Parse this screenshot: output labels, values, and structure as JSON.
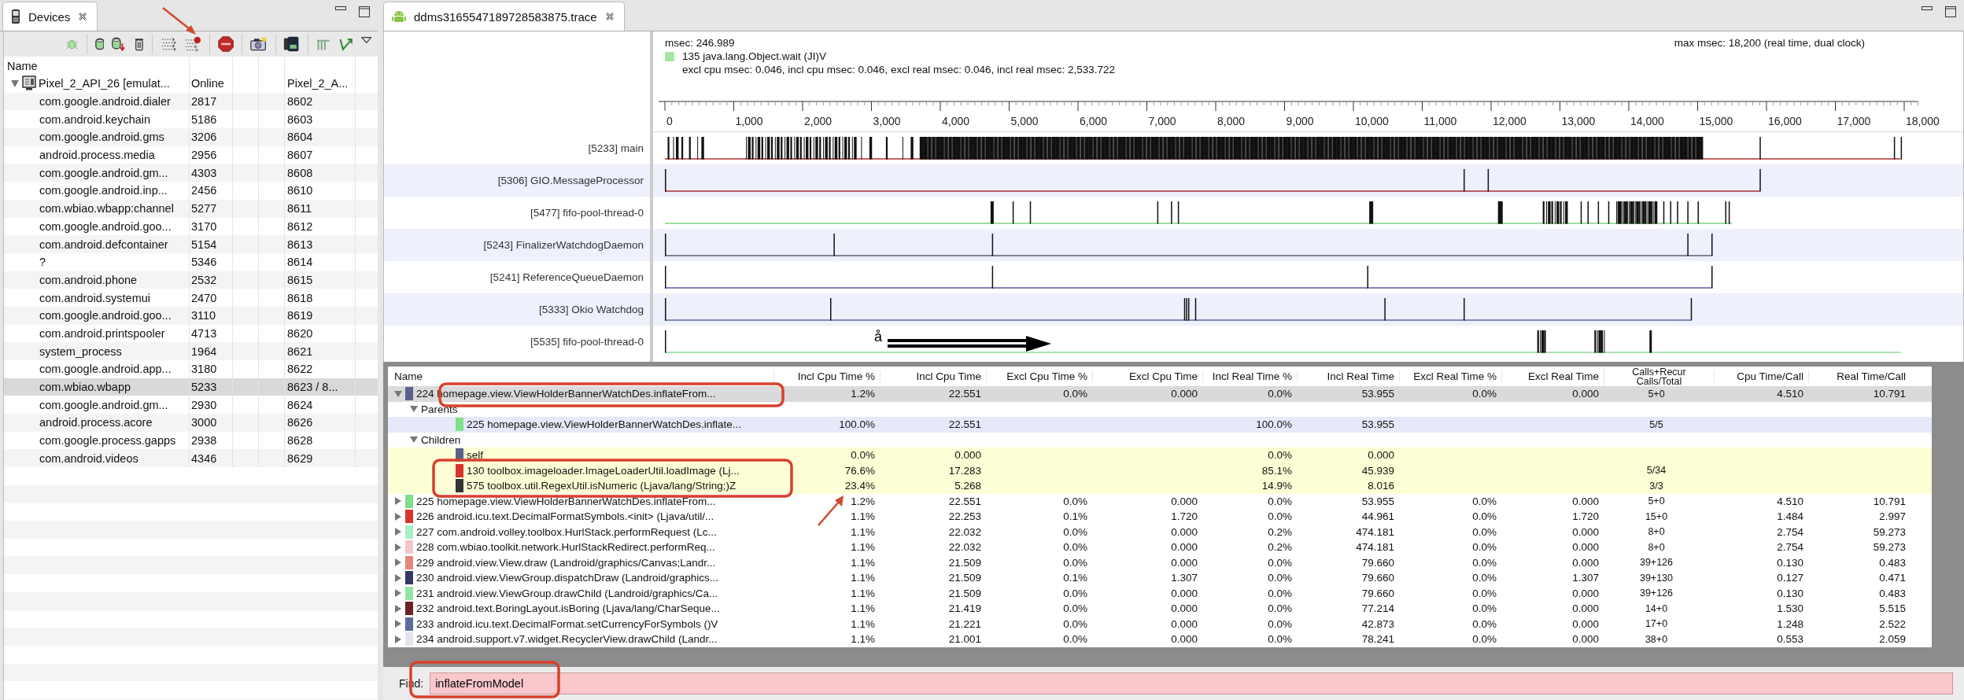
{
  "devices_panel": {
    "tab": {
      "label": "Devices"
    },
    "columns": [
      "Name"
    ],
    "devices": [
      {
        "name": "Pixel_2_API_26 [emulat...",
        "status": "Online",
        "serial": "Pixel_2_A...",
        "expanded": true,
        "children": [
          {
            "name": "com.google.android.dialer",
            "pid": "2817",
            "port": "8602",
            "selected": false
          },
          {
            "name": "com.android.keychain",
            "pid": "5186",
            "port": "8603",
            "selected": false
          },
          {
            "name": "com.google.android.gms",
            "pid": "3206",
            "port": "8604",
            "selected": false
          },
          {
            "name": "android.process.media",
            "pid": "2956",
            "port": "8607",
            "selected": false
          },
          {
            "name": "com.google.android.gm...",
            "pid": "4303",
            "port": "8608",
            "selected": false
          },
          {
            "name": "com.google.android.inp...",
            "pid": "2456",
            "port": "8610",
            "selected": false
          },
          {
            "name": "com.wbiao.wbapp:channel",
            "pid": "5277",
            "port": "8611",
            "selected": false
          },
          {
            "name": "com.google.android.goo...",
            "pid": "3170",
            "port": "8612",
            "selected": false
          },
          {
            "name": "com.android.defcontainer",
            "pid": "5154",
            "port": "8613",
            "selected": false
          },
          {
            "name": "?",
            "pid": "5346",
            "port": "8614",
            "selected": false
          },
          {
            "name": "com.android.phone",
            "pid": "2532",
            "port": "8615",
            "selected": false
          },
          {
            "name": "com.android.systemui",
            "pid": "2470",
            "port": "8618",
            "selected": false
          },
          {
            "name": "com.google.android.goo...",
            "pid": "3110",
            "port": "8619",
            "selected": false
          },
          {
            "name": "com.android.printspooler",
            "pid": "4713",
            "port": "8620",
            "selected": false
          },
          {
            "name": "system_process",
            "pid": "1964",
            "port": "8621",
            "selected": false
          },
          {
            "name": "com.google.android.app...",
            "pid": "3180",
            "port": "8622",
            "selected": false
          },
          {
            "name": "com.wbiao.wbapp",
            "pid": "5233",
            "port": "8623 / 8...",
            "selected": true
          },
          {
            "name": "com.google.android.gm...",
            "pid": "2930",
            "port": "8624",
            "selected": false
          },
          {
            "name": "android.process.acore",
            "pid": "3000",
            "port": "8626",
            "selected": false
          },
          {
            "name": "com.google.process.gapps",
            "pid": "2938",
            "port": "8628",
            "selected": false
          },
          {
            "name": "com.android.videos",
            "pid": "4346",
            "port": "8629",
            "selected": false
          }
        ]
      }
    ]
  },
  "trace_panel": {
    "tab": {
      "label": "ddms3165547189728583875.trace"
    },
    "info": {
      "msec": "msec: 246.989",
      "method": "135 java.lang.Object.wait (JI)V",
      "stats": "excl cpu msec: 0.046, incl cpu msec: 0.046, excl real msec: 0.046, incl real msec: 2,533.722",
      "max": "max msec: 18,200 (real time, dual clock)"
    },
    "ruler_labels": [
      "0",
      "1,000",
      "2,000",
      "3,000",
      "4,000",
      "5,000",
      "6,000",
      "7,000",
      "8,000",
      "9,000",
      "10,000",
      "11,000",
      "12,000",
      "13,000",
      "14,000",
      "15,000",
      "16,000",
      "17,000",
      "18,000"
    ],
    "threads": [
      {
        "name": "[5233] main"
      },
      {
        "name": "[5306] GIO.MessageProcessor"
      },
      {
        "name": "[5477] fifo-pool-thread-0"
      },
      {
        "name": "[5243] FinalizerWatchdogDaemon"
      },
      {
        "name": "[5241] ReferenceQueueDaemon"
      },
      {
        "name": "[5333] Okio Watchdog"
      },
      {
        "name": "[5535] fifo-pool-thread-0"
      }
    ],
    "annotation_mark": "å",
    "table": {
      "columns": [
        "Name",
        "Incl Cpu Time %",
        "Incl Cpu Time",
        "Excl Cpu Time %",
        "Excl Cpu Time",
        "Incl Real Time %",
        "Incl Real Time",
        "Excl Real Time %",
        "Excl Real Time",
        "Calls+Recur Calls/Total",
        "Cpu Time/Call",
        "Real Time/Call"
      ],
      "rows": [
        {
          "kind": "method",
          "expanded": true,
          "selected": true,
          "color": "#5b5f8c",
          "name": "224 homepage.view.ViewHolderBannerWatchDes.inflateFrom...",
          "cells": [
            "1.2%",
            "22.551",
            "0.0%",
            "0.000",
            "0.0%",
            "53.955",
            "0.0%",
            "0.000",
            "5+0",
            "4.510",
            "10.791"
          ]
        },
        {
          "kind": "group",
          "expanded": true,
          "name": "Parents"
        },
        {
          "kind": "parent",
          "color": "#7fe08c",
          "name": "225 homepage.view.ViewHolderBannerWatchDes.inflate...",
          "cells": [
            "100.0%",
            "22.551",
            null,
            null,
            "100.0%",
            "53.955",
            null,
            null,
            "5/5",
            null,
            null
          ]
        },
        {
          "kind": "group",
          "expanded": true,
          "name": "Children"
        },
        {
          "kind": "child",
          "color": "#5b5f8c",
          "name": "self",
          "cells": [
            "0.0%",
            "0.000",
            null,
            null,
            "0.0%",
            "0.000",
            null,
            null,
            null,
            null,
            null
          ]
        },
        {
          "kind": "child",
          "color": "#d8352a",
          "name": "130 toolbox.imageloader.ImageLoaderUtil.loadImage (Lj...",
          "cells": [
            "76.6%",
            "17.283",
            null,
            null,
            "85.1%",
            "45.939",
            null,
            null,
            "5/34",
            null,
            null
          ]
        },
        {
          "kind": "child",
          "color": "#333333",
          "name": "575 toolbox.util.RegexUtil.isNumeric (Ljava/lang/String;)Z",
          "cells": [
            "23.4%",
            "5.268",
            null,
            null,
            "14.9%",
            "8.016",
            null,
            null,
            "3/3",
            null,
            null
          ]
        },
        {
          "kind": "method",
          "expanded": false,
          "selected": false,
          "color": "#7fe08c",
          "name": "225 homepage.view.ViewHolderBannerWatchDes.inflateFrom...",
          "cells": [
            "1.2%",
            "22.551",
            "0.0%",
            "0.000",
            "0.0%",
            "53.955",
            "0.0%",
            "0.000",
            "5+0",
            "4.510",
            "10.791"
          ]
        },
        {
          "kind": "method",
          "expanded": false,
          "selected": false,
          "color": "#d8352a",
          "name": "226 android.icu.text.DecimalFormatSymbols.<init> (Ljava/util/...",
          "cells": [
            "1.1%",
            "22.253",
            "0.1%",
            "1.720",
            "0.0%",
            "44.961",
            "0.0%",
            "1.720",
            "15+0",
            "1.484",
            "2.997"
          ]
        },
        {
          "kind": "method",
          "expanded": false,
          "selected": false,
          "color": "#a6f0c8",
          "name": "227 com.android.volley.toolbox.HurlStack.performRequest (Lc...",
          "cells": [
            "1.1%",
            "22.032",
            "0.0%",
            "0.000",
            "0.2%",
            "474.181",
            "0.0%",
            "0.000",
            "8+0",
            "2.754",
            "59.273"
          ]
        },
        {
          "kind": "method",
          "expanded": false,
          "selected": false,
          "color": "#f2c6ca",
          "name": "228 com.wbiao.toolkit.network.HurlStackRedirect.performReq...",
          "cells": [
            "1.1%",
            "22.032",
            "0.0%",
            "0.000",
            "0.2%",
            "474.181",
            "0.0%",
            "0.000",
            "8+0",
            "2.754",
            "59.273"
          ]
        },
        {
          "kind": "method",
          "expanded": false,
          "selected": false,
          "color": "#e0887a",
          "name": "229 android.view.View.draw (Landroid/graphics/Canvas;Landr...",
          "cells": [
            "1.1%",
            "21.509",
            "0.0%",
            "0.000",
            "0.0%",
            "79.660",
            "0.0%",
            "0.000",
            "39+126",
            "0.130",
            "0.483"
          ]
        },
        {
          "kind": "method",
          "expanded": false,
          "selected": false,
          "color": "#383868",
          "name": "230 android.view.ViewGroup.dispatchDraw (Landroid/graphics...",
          "cells": [
            "1.1%",
            "21.509",
            "0.1%",
            "1.307",
            "0.0%",
            "79.660",
            "0.0%",
            "1.307",
            "39+130",
            "0.127",
            "0.471"
          ]
        },
        {
          "kind": "method",
          "expanded": false,
          "selected": false,
          "color": "#92e6a2",
          "name": "231 android.view.ViewGroup.drawChild (Landroid/graphics/Ca...",
          "cells": [
            "1.1%",
            "21.509",
            "0.0%",
            "0.000",
            "0.0%",
            "79.660",
            "0.0%",
            "0.000",
            "39+126",
            "0.130",
            "0.483"
          ]
        },
        {
          "kind": "method",
          "expanded": false,
          "selected": false,
          "color": "#6a2222",
          "name": "232 android.text.BoringLayout.isBoring (Ljava/lang/CharSeque...",
          "cells": [
            "1.1%",
            "21.419",
            "0.0%",
            "0.000",
            "0.0%",
            "77.214",
            "0.0%",
            "0.000",
            "14+0",
            "1.530",
            "5.515"
          ]
        },
        {
          "kind": "method",
          "expanded": false,
          "selected": false,
          "color": "#5e6c9c",
          "name": "233 android.icu.text.DecimalFormat.setCurrencyForSymbols ()V",
          "cells": [
            "1.1%",
            "21.221",
            "0.0%",
            "0.000",
            "0.0%",
            "42.873",
            "0.0%",
            "0.000",
            "17+0",
            "1.248",
            "2.522"
          ]
        },
        {
          "kind": "method",
          "expanded": false,
          "selected": false,
          "color": "#e4e4ee",
          "name": "234 android.support.v7.widget.RecyclerView.drawChild (Landr...",
          "cells": [
            "1.1%",
            "21.001",
            "0.0%",
            "0.000",
            "0.0%",
            "78.241",
            "0.0%",
            "0.000",
            "38+0",
            "0.553",
            "2.059"
          ]
        }
      ]
    },
    "find": {
      "label": "Find:",
      "value": "inflateFromModel"
    }
  }
}
